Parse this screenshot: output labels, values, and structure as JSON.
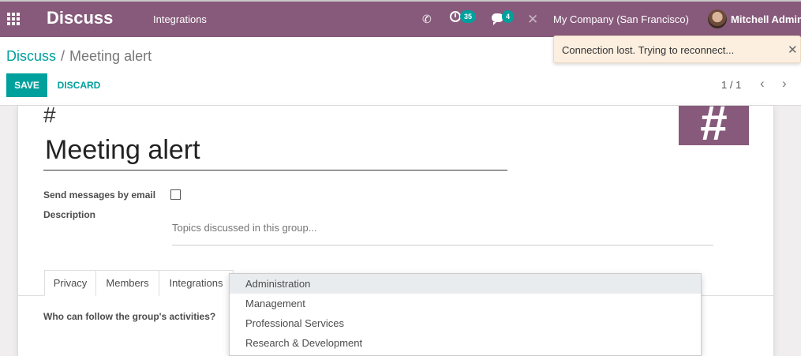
{
  "navbar": {
    "brand": "Discuss",
    "menu_item": "Integrations",
    "activity_count": "35",
    "message_count": "4",
    "company": "My Company (San Francisco)",
    "user": "Mitchell Admin",
    "color": "#875a7b"
  },
  "breadcrumb": {
    "parent": "Discuss",
    "separator": "/",
    "current": "Meeting alert"
  },
  "buttons": {
    "save": "SAVE",
    "discard": "DISCARD"
  },
  "pager": {
    "value": "1 / 1"
  },
  "notification": {
    "message": "Connection lost. Trying to reconnect..."
  },
  "form": {
    "hash_symbol": "#",
    "channel_name": "Meeting alert",
    "send_email_label": "Send messages by email",
    "send_email_checked": false,
    "description_label": "Description",
    "description_placeholder": "Topics discussed in this group...",
    "follow_label": "Who can follow the group's activities?"
  },
  "tabs": [
    {
      "label": "Privacy",
      "active": true
    },
    {
      "label": "Members",
      "active": false
    },
    {
      "label": "Integrations",
      "active": false
    }
  ],
  "dropdown": {
    "items": [
      {
        "label": "Administration",
        "active": true
      },
      {
        "label": "Management",
        "active": false
      },
      {
        "label": "Professional Services",
        "active": false
      },
      {
        "label": "Research & Development",
        "active": false
      }
    ]
  },
  "colors": {
    "primary": "#00a09d",
    "brand": "#875a7b",
    "notification_bg": "#fcefe0"
  }
}
